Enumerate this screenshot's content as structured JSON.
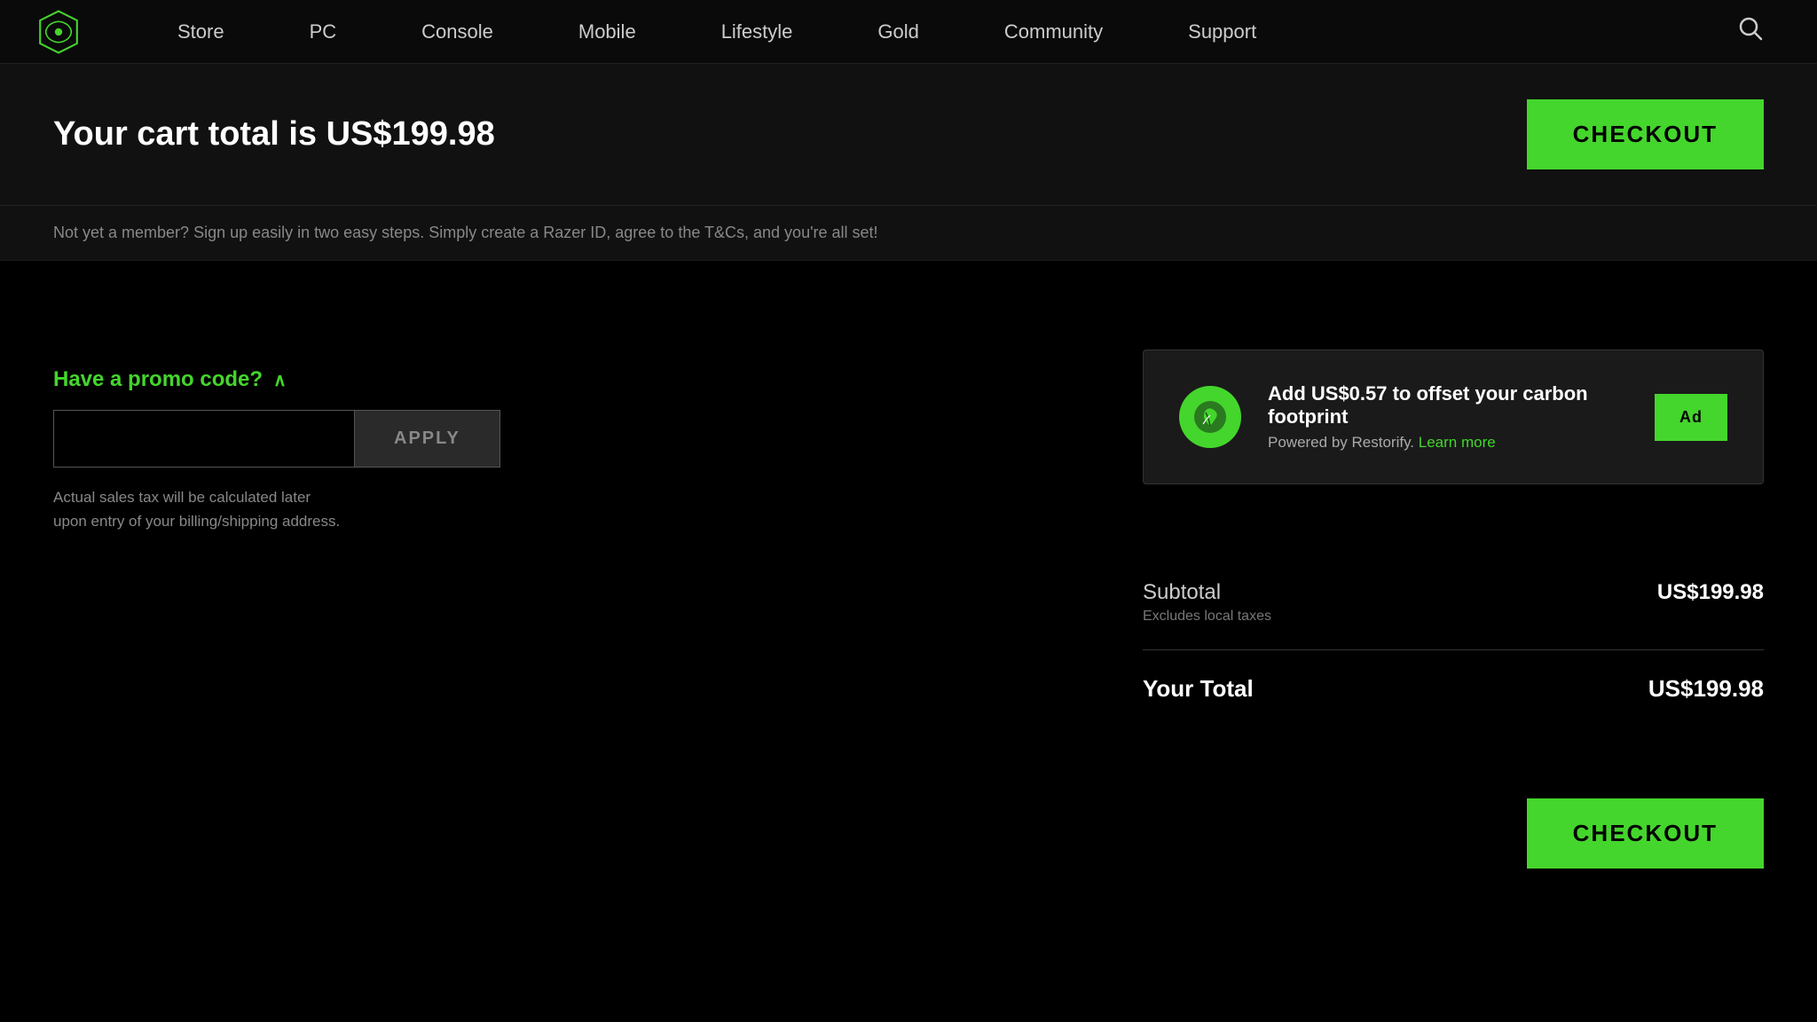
{
  "brand": {
    "name": "Razer",
    "logo_alt": "Razer Logo"
  },
  "nav": {
    "items": [
      {
        "label": "Store",
        "id": "store"
      },
      {
        "label": "PC",
        "id": "pc"
      },
      {
        "label": "Console",
        "id": "console"
      },
      {
        "label": "Mobile",
        "id": "mobile"
      },
      {
        "label": "Lifestyle",
        "id": "lifestyle"
      },
      {
        "label": "Gold",
        "id": "gold"
      },
      {
        "label": "Community",
        "id": "community"
      },
      {
        "label": "Support",
        "id": "support"
      }
    ],
    "search_icon": "🔍"
  },
  "cart_header": {
    "total_text": "Your cart total is US$199.98",
    "checkout_label": "CHECKOUT"
  },
  "member_banner": {
    "text_prefix": "Not yet a member? Sign up easily in two easy steps. Simply create a Razer ID, agree to the T&Cs, and you're all set!"
  },
  "carbon_offset": {
    "title": "Add US$0.57 to offset your carbon footprint",
    "subtitle": "Powered by Restorify.",
    "learn_more": "Learn more",
    "add_label": "Ad",
    "icon": "🌱"
  },
  "promo": {
    "label": "Have a promo code?",
    "chevron": "∧",
    "input_placeholder": "",
    "apply_label": "APPLY"
  },
  "tax_notice": {
    "line1": "Actual sales tax will be calculated later",
    "line2": "upon entry of your billing/shipping address."
  },
  "order_summary": {
    "subtotal_label": "Subtotal",
    "subtotal_sublabel": "Excludes local taxes",
    "subtotal_value": "US$199.98",
    "total_label": "Your Total",
    "total_value": "US$199.98"
  },
  "bottom_checkout": {
    "label": "CHECKOUT"
  },
  "colors": {
    "accent": "#44d62c",
    "bg": "#000",
    "surface": "#111",
    "muted": "#888"
  }
}
